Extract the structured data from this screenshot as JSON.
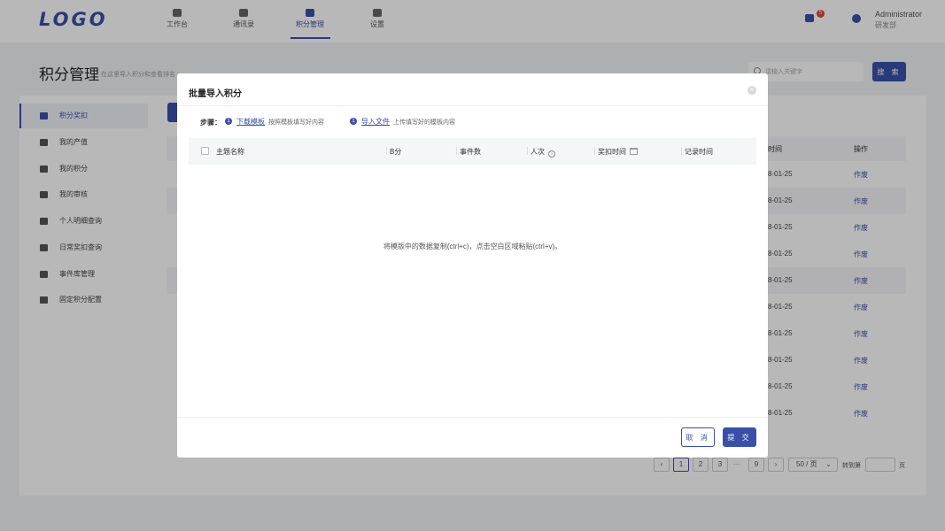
{
  "header": {
    "logo": "LOGO",
    "nav": [
      {
        "label": "工作台",
        "icon": "desktop-icon"
      },
      {
        "label": "通讯录",
        "icon": "contacts-icon"
      },
      {
        "label": "积分管理",
        "icon": "points-icon",
        "active": true
      },
      {
        "label": "设置",
        "icon": "gear-icon"
      }
    ],
    "message_badge": "5",
    "user_name": "Administrator",
    "user_dept": "研发部"
  },
  "page": {
    "title": "积分管理",
    "subtitle": "在这里导入积分和查看排名",
    "search_placeholder": "请输入关键字",
    "search_button": "搜 索"
  },
  "sidebar": {
    "items": [
      {
        "label": "积分奖扣",
        "active": true
      },
      {
        "label": "我的产值"
      },
      {
        "label": "我的积分"
      },
      {
        "label": "我的审核"
      },
      {
        "label": "个人明细查询"
      },
      {
        "label": "日常奖扣查询"
      },
      {
        "label": "事件库管理"
      },
      {
        "label": "固定积分配置"
      }
    ]
  },
  "background_table": {
    "headers": [
      "时间",
      "操作"
    ],
    "rows": [
      {
        "date": "8-01-25",
        "op": "作废"
      },
      {
        "date": "8-01-25",
        "op": "作废"
      },
      {
        "date": "8-01-25",
        "op": "作废"
      },
      {
        "date": "8-01-25",
        "op": "作废"
      },
      {
        "date": "8-01-25",
        "op": "作废"
      },
      {
        "date": "8-01-25",
        "op": "作废"
      },
      {
        "date": "8-01-25",
        "op": "作废"
      },
      {
        "date": "8-01-25",
        "op": "作废"
      },
      {
        "date": "8-01-25",
        "op": "作废"
      },
      {
        "date": "8-01-25",
        "op": "作废"
      }
    ]
  },
  "pagination": {
    "pages": [
      "1",
      "2",
      "3"
    ],
    "dots": "···",
    "last_page": "9",
    "page_size": "50 / 页",
    "goto_label": "转到第",
    "page_unit": "页"
  },
  "modal": {
    "title": "批量导入积分",
    "steps_label": "步骤：",
    "step1_num": "1",
    "step1_link": "下载模板",
    "step1_desc": "按照模板填写好内容",
    "step2_num": "1",
    "step2_link": "导入文件",
    "step2_desc": "上传填写好的模板内容",
    "columns": [
      "主题名称",
      "B分",
      "事件数",
      "人次",
      "奖扣时间",
      "记录时间"
    ],
    "paste_hint": "将模版中的数据复制(ctrl+c)，点击空白区域粘贴(ctrl+v)。",
    "cancel": "取 消",
    "submit": "提 交"
  }
}
